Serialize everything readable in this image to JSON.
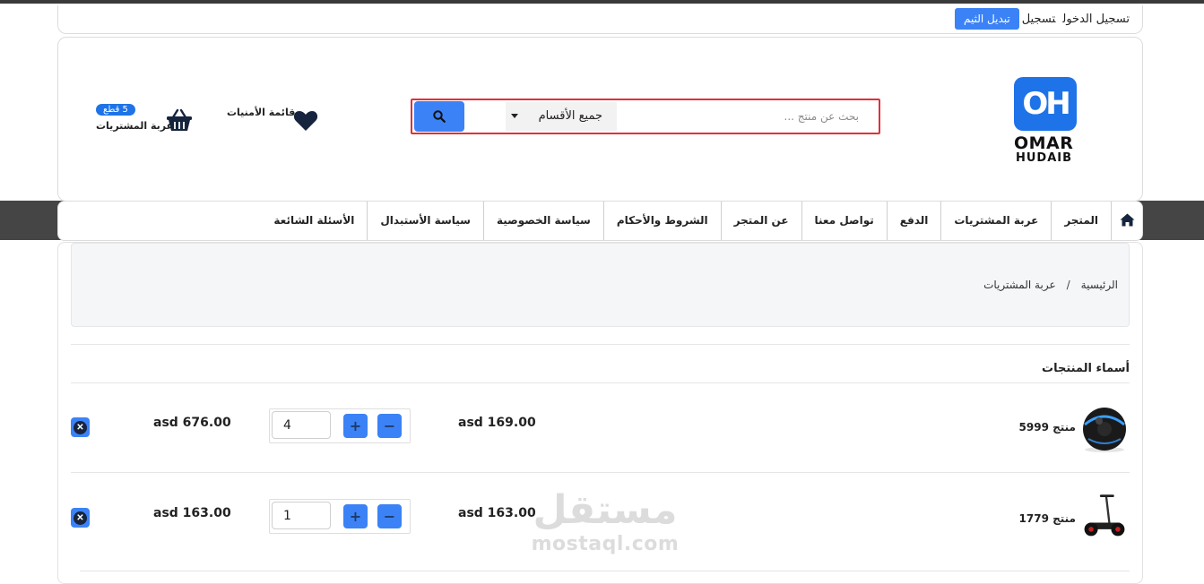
{
  "topbar": {
    "login": "تسجيل الدخول",
    "register": "تسجيل",
    "theme_button": "تبديل الثيم"
  },
  "logo": {
    "mark": "OH",
    "name_line1": "OMAR",
    "name_line2": "HUDAIB"
  },
  "search": {
    "placeholder": "بحث عن منتج ...",
    "category": "جميع الأقسام",
    "button_icon": "search-icon"
  },
  "wishlist": {
    "label": "قائمة الأمنيات",
    "icon": "heart-icon"
  },
  "cart": {
    "count_badge": "5 قطع",
    "label": "عربة المشتريات",
    "icon": "basket-icon"
  },
  "nav": {
    "home_icon": "home-icon",
    "items": [
      "المتجر",
      "عربة المشتريات",
      "الدفع",
      "تواصل معنا",
      "عن المتجر",
      "الشروط والأحكام",
      "سياسة الخصوصية",
      "سياسة الأستبدال",
      "الأسئلة الشائعة"
    ]
  },
  "breadcrumb": {
    "home": "الرئيسية",
    "separator": "/",
    "current": "عربة المشتريات"
  },
  "cart_table": {
    "column_header": "أسماء المنتجات",
    "rows": [
      {
        "name": "منتج 5999",
        "unit_price": "asd 169.00",
        "quantity": "4",
        "total": "asd 676.00",
        "image": "robot-ball-image"
      },
      {
        "name": "منتج 1779",
        "unit_price": "asd 163.00",
        "quantity": "1",
        "total": "asd 163.00",
        "image": "hoverboard-image"
      }
    ]
  },
  "watermark": {
    "arabic": "مستقل",
    "latin": "mostaql.com"
  },
  "colors": {
    "accent": "#3b82f6",
    "brand": "#1e73e8",
    "search_border": "#e0303a",
    "nav_band": "#454545"
  }
}
